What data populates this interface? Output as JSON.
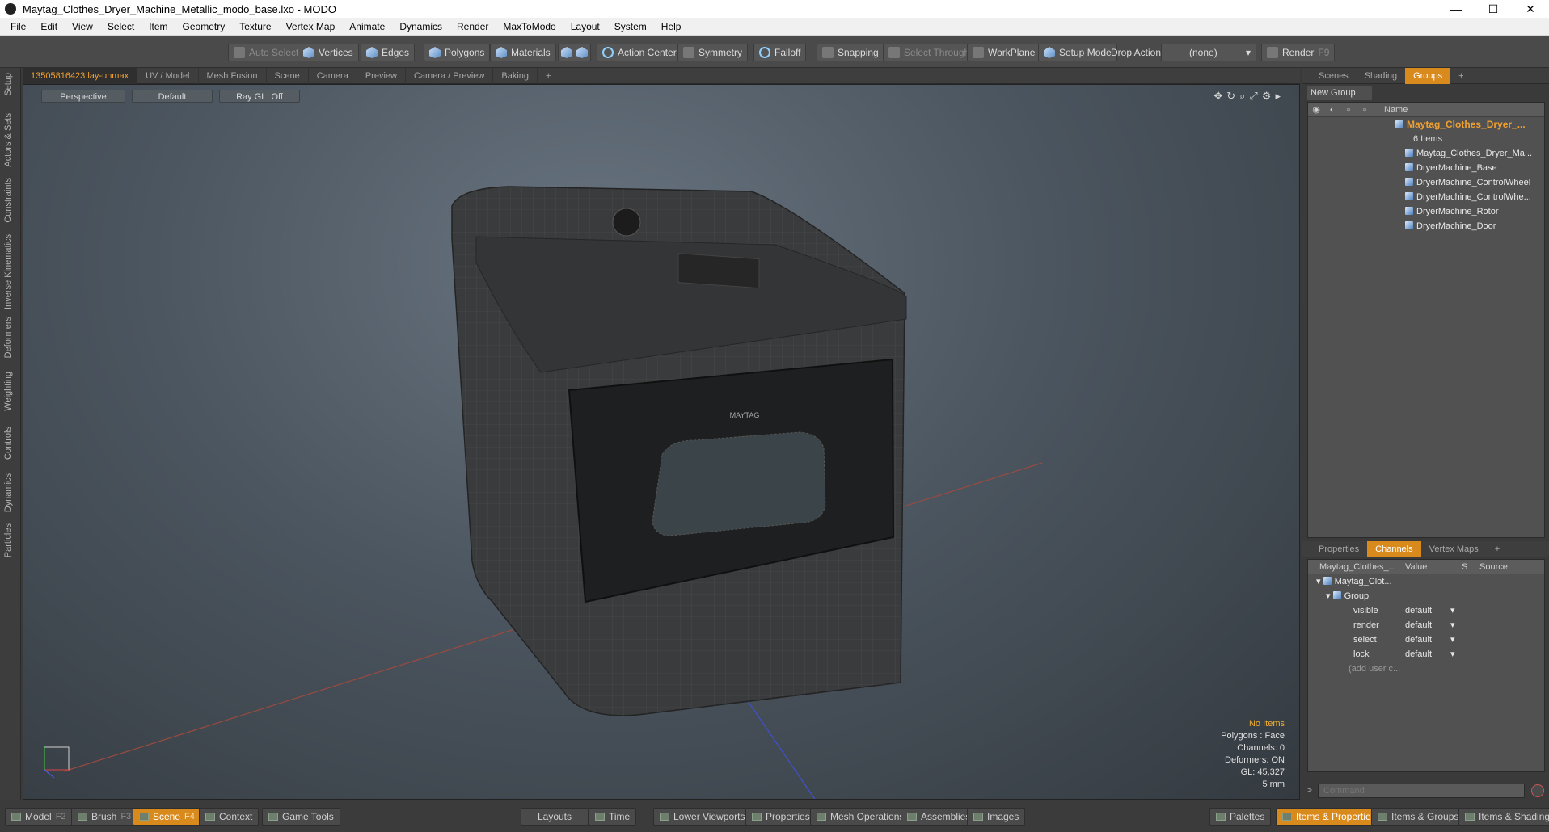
{
  "window": {
    "title": "Maytag_Clothes_Dryer_Machine_Metallic_modo_base.lxo - MODO",
    "minimize": "—",
    "maximize": "☐",
    "close": "✕"
  },
  "menu": [
    "File",
    "Edit",
    "View",
    "Select",
    "Item",
    "Geometry",
    "Texture",
    "Vertex Map",
    "Animate",
    "Dynamics",
    "Render",
    "MaxToModo",
    "Layout",
    "System",
    "Help"
  ],
  "toolbar": {
    "auto_select": "Auto Select",
    "vertices": "Vertices",
    "edges": "Edges",
    "polygons": "Polygons",
    "materials": "Materials",
    "action_center": "Action Center",
    "symmetry": "Symmetry",
    "falloff": "Falloff",
    "snapping": "Snapping",
    "select_through": "Select Through",
    "workplane": "WorkPlane",
    "setup_mode": "Setup Mode",
    "drop_action": "Drop Action",
    "drop_value": "(none)",
    "render": "Render",
    "render_key": "F9"
  },
  "left_tabs": [
    "Setup",
    "Actors & Sets",
    "Constraints",
    "Inverse Kinematics",
    "Deformers",
    "Weighting",
    "Controls",
    "Dynamics",
    "Particles"
  ],
  "viewport_tabs": [
    "13505816423:lay-unmax",
    "UV / Model",
    "Mesh Fusion",
    "Scene",
    "Camera",
    "Preview",
    "Camera / Preview",
    "Baking",
    "+"
  ],
  "viewport": {
    "perspective": "Perspective",
    "shading": "Default",
    "raygl": "Ray GL: Off",
    "brand": "MAYTAG",
    "info": {
      "items": "No Items",
      "polygons": "Polygons : Face",
      "channels": "Channels: 0",
      "deformers": "Deformers: ON",
      "gl": "GL: 45,327",
      "scale": "5 mm"
    }
  },
  "scene_tabs": [
    "Scenes",
    "Shading",
    "Groups",
    "+"
  ],
  "groups": {
    "new_group": "New Group",
    "col_name": "Name",
    "root": "Maytag_Clothes_Dryer_...",
    "root_count": "6 Items",
    "items": [
      "Maytag_Clothes_Dryer_Ma...",
      "DryerMachine_Base",
      "DryerMachine_ControlWheel",
      "DryerMachine_ControlWhe...",
      "DryerMachine_Rotor",
      "DryerMachine_Door"
    ]
  },
  "props_tabs": [
    "Properties",
    "Channels",
    "Vertex Maps",
    "+"
  ],
  "channels": {
    "col_name": "Maytag_Clothes_...",
    "col_value": "Value",
    "col_s": "S",
    "col_source": "Source",
    "root": "Maytag_Clot...",
    "group": "Group",
    "rows": [
      {
        "name": "visible",
        "value": "default"
      },
      {
        "name": "render",
        "value": "default"
      },
      {
        "name": "select",
        "value": "default"
      },
      {
        "name": "lock",
        "value": "default"
      }
    ],
    "add": "(add user c..."
  },
  "command": {
    "placeholder": "Command"
  },
  "bottom": {
    "model": "Model",
    "model_key": "F2",
    "brush": "Brush",
    "brush_key": "F3",
    "scene": "Scene",
    "scene_key": "F4",
    "context": "Context",
    "game_tools": "Game Tools",
    "layouts": "Layouts",
    "time": "Time",
    "lower_viewports": "Lower Viewports",
    "properties": "Properties",
    "mesh_operations": "Mesh Operations",
    "assemblies": "Assemblies",
    "images": "Images",
    "palettes": "Palettes",
    "items_properties": "Items & Properties",
    "items_groups": "Items & Groups",
    "items_shading": "Items & Shading"
  }
}
